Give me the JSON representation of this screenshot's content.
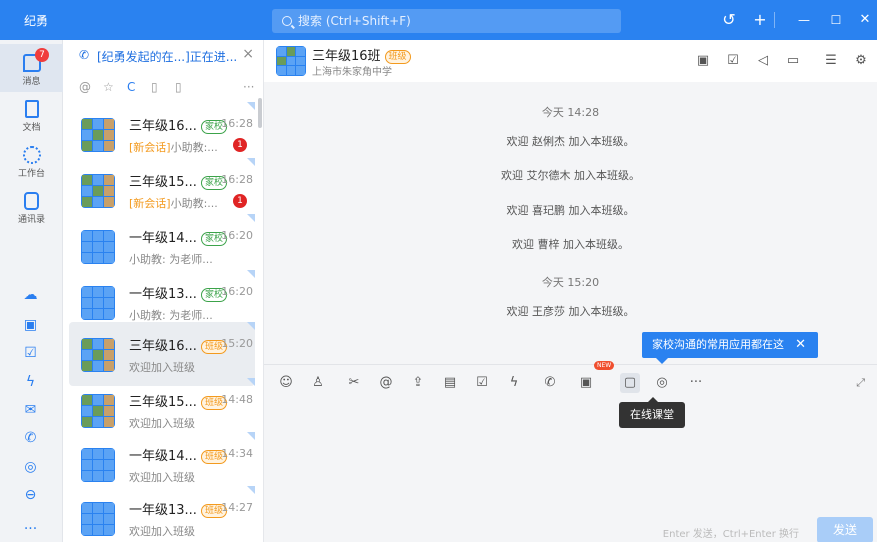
{
  "titlebar": {
    "app_name": "纪勇",
    "search_placeholder": "搜索 (Ctrl+Shift+F)",
    "history_icon": "↺",
    "add_icon": "+",
    "minimize_icon": "—",
    "maximize_icon": "☐",
    "close_icon": "✕"
  },
  "nav": {
    "messages_label": "消息",
    "messages_badge": "7",
    "docs_label": "文档",
    "workbench_label": "工作台",
    "contacts_label": "通讯录",
    "more_label": "···"
  },
  "list": {
    "live_text": "[纪勇发起的在...]正在进...",
    "live_close": "×",
    "tools": [
      "@",
      "☆",
      "C",
      "▯",
      "▯",
      "···"
    ],
    "items": [
      {
        "name": "三年级16...",
        "tag": "家校",
        "time": "16:28",
        "new_label": "[新会话]",
        "preview": "小助教:...",
        "unread": "1"
      },
      {
        "name": "三年级15...",
        "tag": "家校",
        "time": "16:28",
        "new_label": "[新会话]",
        "preview": "小助教:...",
        "unread": "1"
      },
      {
        "name": "一年级14...",
        "tag": "家校",
        "time": "16:20",
        "new_label": "",
        "preview": "小助教: 为老师...",
        "unread": ""
      },
      {
        "name": "一年级13...",
        "tag": "家校",
        "time": "16:20",
        "new_label": "",
        "preview": "小助教: 为老师...",
        "unread": ""
      },
      {
        "name": "三年级16...",
        "tag": "班级",
        "time": "15:20",
        "new_label": "",
        "preview": "欢迎加入班级",
        "unread": ""
      },
      {
        "name": "三年级15...",
        "tag": "班级",
        "time": "14:48",
        "new_label": "",
        "preview": "欢迎加入班级",
        "unread": ""
      },
      {
        "name": "一年级14...",
        "tag": "班级",
        "time": "14:34",
        "new_label": "",
        "preview": "欢迎加入班级",
        "unread": ""
      },
      {
        "name": "一年级13...",
        "tag": "班级",
        "time": "14:27",
        "new_label": "",
        "preview": "欢迎加入班级",
        "unread": ""
      }
    ]
  },
  "chat": {
    "title": "三年级16班",
    "title_tag": "班级",
    "subtitle": "上海市朱家角中学",
    "messages": [
      {
        "type": "time",
        "text": "今天 14:28"
      },
      {
        "type": "sys",
        "text": "欢迎 赵俐杰 加入本班级。"
      },
      {
        "type": "sys",
        "text": "欢迎 艾尔德木 加入本班级。"
      },
      {
        "type": "sys",
        "text": "欢迎 喜玘鹏 加入本班级。"
      },
      {
        "type": "sys",
        "text": "欢迎 曹梓 加入本班级。"
      },
      {
        "type": "time",
        "text": "今天 15:20"
      },
      {
        "type": "sys",
        "text": "欢迎 王彦莎 加入本班级。"
      }
    ],
    "tip_text": "家校沟通的常用应用都在这",
    "tip_close": "✕",
    "tooltip_text": "在线课堂",
    "new_badge": "NEW",
    "send_hint": "Enter 发送，Ctrl+Enter 换行",
    "send_label": "发送"
  }
}
